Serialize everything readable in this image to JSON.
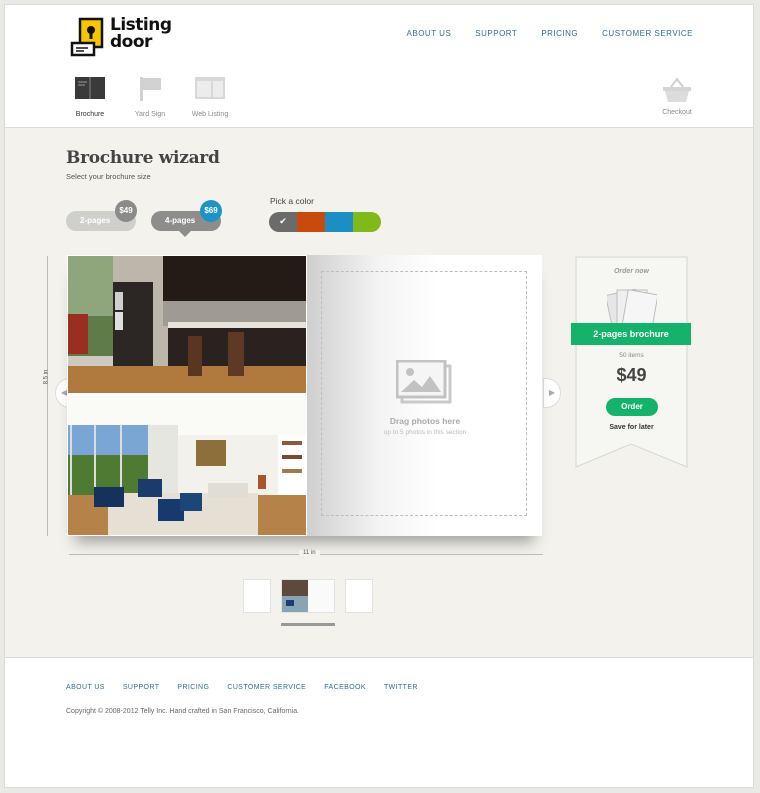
{
  "brand": {
    "name_line1": "Listing",
    "name_line2": "door"
  },
  "topnav": [
    "ABOUT US",
    "SUPPORT",
    "PRICING",
    "CUSTOMER SERVICE"
  ],
  "tools": [
    {
      "label": "Brochure",
      "icon": "brochure-icon",
      "active": true
    },
    {
      "label": "Yard Sign",
      "icon": "yard-sign-icon",
      "active": false
    },
    {
      "label": "Web Listing",
      "icon": "web-listing-icon",
      "active": false
    }
  ],
  "checkout": {
    "label": "Checkout",
    "icon": "basket-icon"
  },
  "wizard": {
    "title": "Brochure wizard",
    "subtitle": "Select your brochure size",
    "sizes": [
      {
        "label": "2-pages",
        "price": "$49"
      },
      {
        "label": "4-pages",
        "price": "$69",
        "selected": true
      }
    ],
    "color_label": "Pick a color",
    "colors": [
      "#6b6b6b",
      "#c84a0c",
      "#1b8ec4",
      "#7fb91a"
    ],
    "selected_color_index": 0,
    "height_label": "8.5 in",
    "width_label": "11 in"
  },
  "dropzone": {
    "title": "Drag photos here",
    "subtitle": "up to 5 photos in this section"
  },
  "order": {
    "header": "Order now",
    "product": "2-pages brochure",
    "items": "50 items",
    "price": "$49",
    "order_label": "Order",
    "save_label": "Save for later"
  },
  "footer": {
    "links": [
      "ABOUT US",
      "SUPPORT",
      "PRICING",
      "CUSTOMER SERVICE",
      "FACEBOOK",
      "TWITTER"
    ],
    "copyright": "Copyright © 2008-2012 Telly Inc. Hand crafted in San Francisco, California."
  },
  "colors": {
    "accent_green": "#15b26c",
    "link_blue": "#2e6f98",
    "badge_blue": "#1e93c8"
  }
}
